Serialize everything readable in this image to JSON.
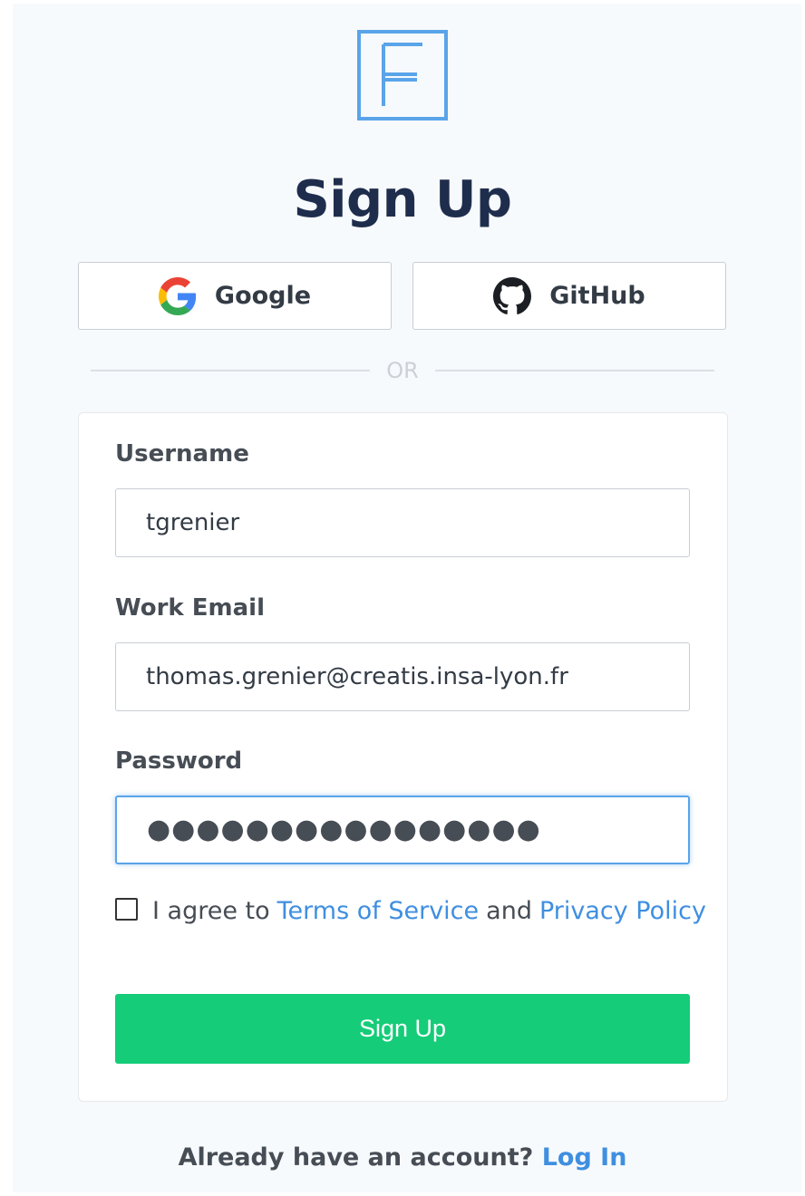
{
  "brand": {
    "logo_icon": "f-logo-icon",
    "logo_color": "#5aa4e9"
  },
  "title": "Sign Up",
  "oauth": {
    "google_label": "Google",
    "google_icon": "google-icon",
    "github_label": "GitHub",
    "github_icon": "github-icon"
  },
  "divider_text": "OR",
  "form": {
    "username": {
      "label": "Username",
      "value": "tgrenier"
    },
    "email": {
      "label": "Work Email",
      "value": "thomas.grenier@creatis.insa-lyon.fr"
    },
    "password": {
      "label": "Password",
      "masked_value": "●●●●●●●●●●●●●●●●"
    },
    "agree": {
      "prefix": "I agree to",
      "terms_link": "Terms of Service",
      "conjunction": "and",
      "privacy_link": "Privacy Policy",
      "checked": false
    },
    "submit_label": "Sign Up"
  },
  "footer": {
    "prompt": "Already have an account?",
    "login_link": "Log In"
  },
  "colors": {
    "accent": "#3f8fe0",
    "submit": "#15cc78",
    "title": "#1f2d4d"
  }
}
